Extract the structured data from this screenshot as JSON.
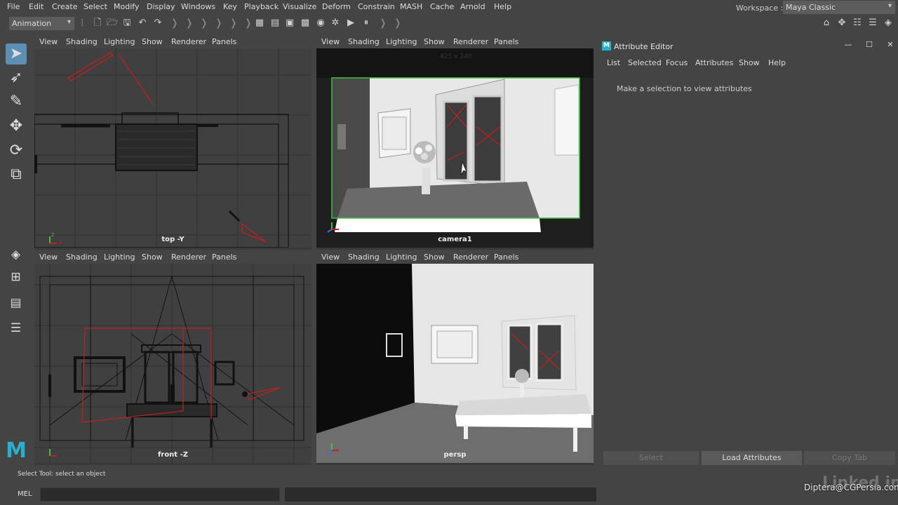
{
  "menubar": {
    "items": [
      "File",
      "Edit",
      "Create",
      "Select",
      "Modify",
      "Display",
      "Windows",
      "Key",
      "Playback",
      "Visualize",
      "Deform",
      "Constrain",
      "MASH",
      "Cache",
      "Arnold",
      "Help"
    ]
  },
  "workspace": {
    "label": "Workspace :",
    "value": "Maya Classic"
  },
  "shelf": {
    "mode": "Animation"
  },
  "viewports": {
    "menu": [
      "View",
      "Shading",
      "Lighting",
      "Show",
      "Renderer",
      "Panels"
    ],
    "top": {
      "label": "top -Y"
    },
    "camera1": {
      "label": "camera1",
      "resolution": "425 x 240"
    },
    "front": {
      "label": "front -Z"
    },
    "persp": {
      "label": "persp"
    }
  },
  "attribute_editor": {
    "title": "Attribute Editor",
    "menu": [
      "List",
      "Selected",
      "Focus",
      "Attributes",
      "Show",
      "Help"
    ],
    "message": "Make a selection to view attributes",
    "buttons": {
      "select": "Select",
      "load": "Load Attributes",
      "copy": "Copy Tab"
    }
  },
  "helpline": {
    "text": "Select Tool: select an object"
  },
  "cmdline": {
    "label": "MEL"
  },
  "watermark": {
    "text": "Diptera@CGPersia.com",
    "logo": "Linked in"
  },
  "colors": {
    "accent": "#5d8fb4",
    "camera_frame": "#3ec23e",
    "light_red": "#c0201f",
    "maya_teal": "#27b0ce"
  },
  "icons": [
    "select-tool-icon",
    "lasso-tool-icon",
    "paint-tool-icon",
    "move-tool-icon",
    "rotate-tool-icon",
    "scale-tool-icon"
  ]
}
